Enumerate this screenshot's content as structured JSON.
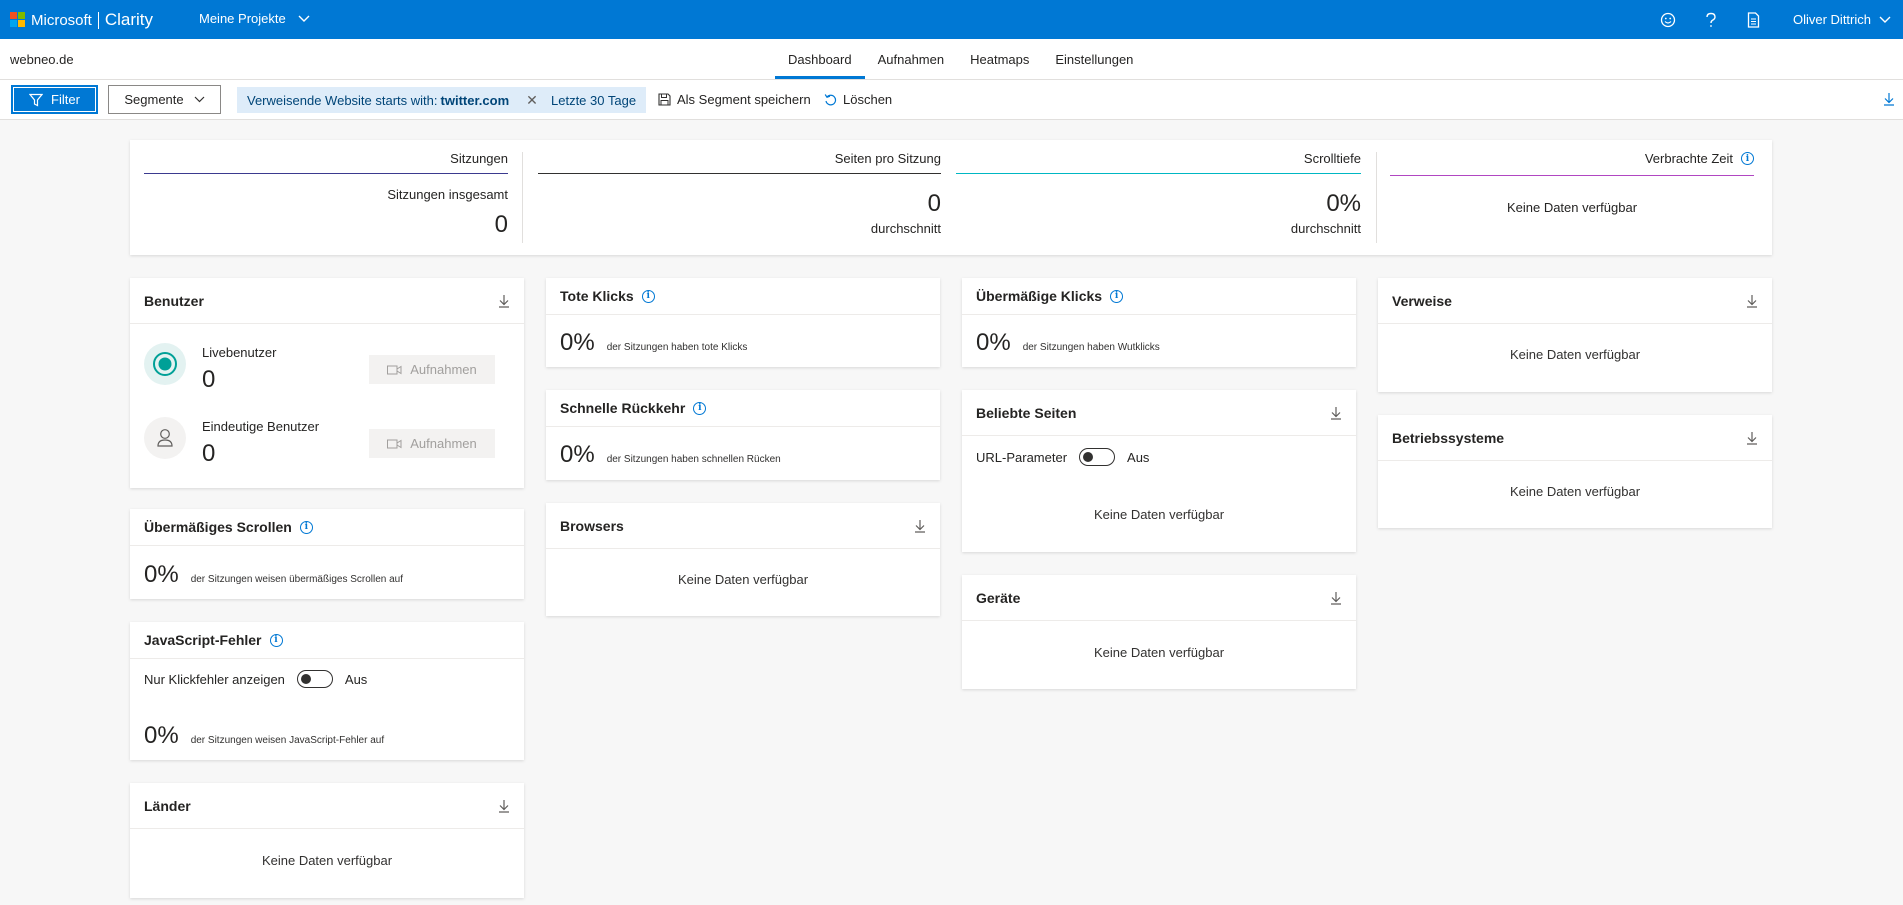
{
  "topbar": {
    "brand_microsoft": "Microsoft",
    "brand_clarity": "Clarity",
    "project_label": "Meine Projekte",
    "user_name": "Oliver Dittrich",
    "bg_color": "#0078d4"
  },
  "nav": {
    "site": "webneo.de",
    "tabs": [
      {
        "label": "Dashboard",
        "active": true
      },
      {
        "label": "Aufnahmen",
        "active": false
      },
      {
        "label": "Heatmaps",
        "active": false
      },
      {
        "label": "Einstellungen",
        "active": false
      }
    ]
  },
  "filterbar": {
    "filter_label": "Filter",
    "segment_label": "Segmente",
    "chip_prefix": "Verweisende Website starts with:",
    "chip_value": "twitter.com",
    "date_range": "Letzte 30 Tage",
    "save_segment": "Als Segment speichern",
    "clear": "Löschen"
  },
  "summary": {
    "sessions": {
      "title": "Sitzungen",
      "sub": "Sitzungen insgesamt",
      "value": "0",
      "color": "#3b3a8f"
    },
    "pages": {
      "title": "Seiten pro Sitzung",
      "value": "0",
      "sub": "durchschnitt",
      "color": "#323130"
    },
    "scroll": {
      "title": "Scrolltiefe",
      "value": "0%",
      "sub": "durchschnitt",
      "color": "#00b7c3"
    },
    "time": {
      "title": "Verbrachte Zeit",
      "nodata": "Keine Daten verfügbar",
      "color": "#b146c2"
    }
  },
  "benutzer": {
    "title": "Benutzer",
    "live_label": "Livebenutzer",
    "live_value": "0",
    "unique_label": "Eindeutige Benutzer",
    "unique_value": "0",
    "record_label": "Aufnahmen"
  },
  "uebermaessiges_scrollen": {
    "title": "Übermäßiges Scrollen",
    "value": "0%",
    "desc": "der Sitzungen weisen übermäßiges Scrollen auf"
  },
  "js_fehler": {
    "title": "JavaScript-Fehler",
    "toggle_label": "Nur Klickfehler anzeigen",
    "toggle_state": "Aus",
    "value": "0%",
    "desc": "der Sitzungen weisen JavaScript-Fehler auf"
  },
  "laender": {
    "title": "Länder",
    "nodata": "Keine Daten verfügbar"
  },
  "tote_klicks": {
    "title": "Tote Klicks",
    "value": "0%",
    "desc": "der Sitzungen haben tote Klicks"
  },
  "schnelle_rueckkehr": {
    "title": "Schnelle Rückkehr",
    "value": "0%",
    "desc": "der Sitzungen haben schnellen Rücken"
  },
  "browsers": {
    "title": "Browsers",
    "nodata": "Keine Daten verfügbar"
  },
  "uebermaessige_klicks": {
    "title": "Übermäßige Klicks",
    "value": "0%",
    "desc": "der Sitzungen haben Wutklicks"
  },
  "beliebte_seiten": {
    "title": "Beliebte Seiten",
    "toggle_label": "URL-Parameter",
    "toggle_state": "Aus",
    "nodata": "Keine Daten verfügbar"
  },
  "geraete": {
    "title": "Geräte",
    "nodata": "Keine Daten verfügbar"
  },
  "verweise": {
    "title": "Verweise",
    "nodata": "Keine Daten verfügbar"
  },
  "betriebssysteme": {
    "title": "Betriebssysteme",
    "nodata": "Keine Daten verfügbar"
  }
}
